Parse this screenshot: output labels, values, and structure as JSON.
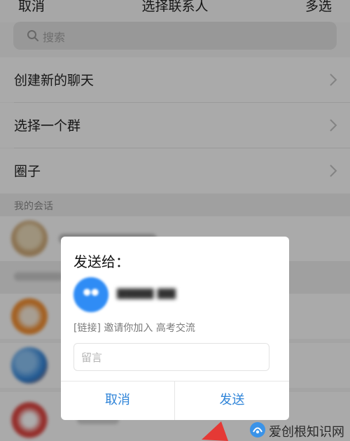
{
  "header": {
    "left": "取消",
    "title": "选择联系人",
    "right": "多选"
  },
  "search": {
    "placeholder": "搜索"
  },
  "menu": {
    "items": [
      {
        "label": "创建新的聊天"
      },
      {
        "label": "选择一个群"
      },
      {
        "label": "圈子"
      }
    ]
  },
  "sections": {
    "my_conversations": "我的会话"
  },
  "dialog": {
    "title": "发送给：",
    "message": "[链接] 邀请你加入 高考交流",
    "input_placeholder": "留言",
    "cancel": "取消",
    "send": "发送"
  },
  "watermark": {
    "text": "爱创根知识网"
  },
  "colors": {
    "accent": "#2f84d8",
    "avatar_blue": "#2f8cf5",
    "arrow_red": "#e53935"
  }
}
